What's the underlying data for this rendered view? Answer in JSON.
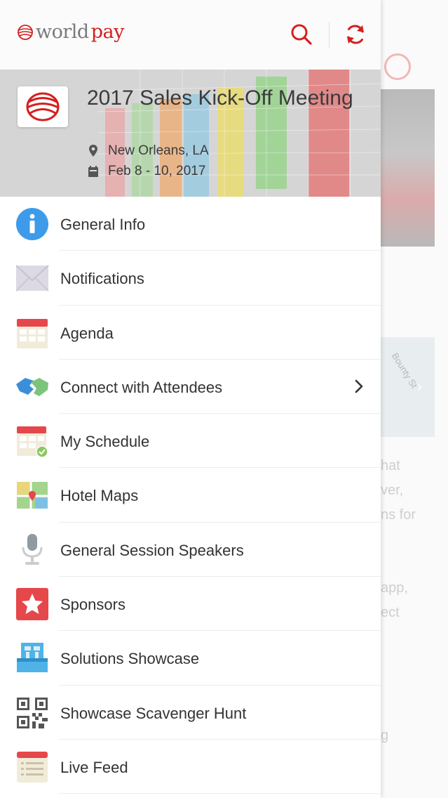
{
  "app": {
    "logo_text_part1": "world",
    "logo_text_part2": "pay",
    "brand_red": "#d51f1f"
  },
  "topbar": {
    "icons": [
      "search-icon",
      "refresh-icon"
    ]
  },
  "event": {
    "title": "2017 Sales Kick-Off Meeting",
    "location": "New Orleans, LA",
    "dates": "Feb 8 - 10, 2017"
  },
  "menu": {
    "items": [
      {
        "label": "General Info",
        "icon": "info-icon"
      },
      {
        "label": "Notifications",
        "icon": "envelope-icon"
      },
      {
        "label": "Agenda",
        "icon": "calendar-icon"
      },
      {
        "label": "Connect with Attendees",
        "icon": "handshake-icon",
        "has_chevron": true
      },
      {
        "label": "My Schedule",
        "icon": "calendar-check-icon"
      },
      {
        "label": "Hotel Maps",
        "icon": "map-icon"
      },
      {
        "label": "General Session Speakers",
        "icon": "microphone-icon"
      },
      {
        "label": "Sponsors",
        "icon": "star-icon"
      },
      {
        "label": "Solutions Showcase",
        "icon": "booth-icon"
      },
      {
        "label": "Showcase Scavenger Hunt",
        "icon": "qr-code-icon"
      },
      {
        "label": "Live Feed",
        "icon": "feed-icon"
      }
    ]
  },
  "background_page": {
    "map_street": "Bounty St",
    "text_fragments": [
      "hat",
      "ver,",
      "ns for",
      "app,",
      "ect",
      "g"
    ]
  }
}
